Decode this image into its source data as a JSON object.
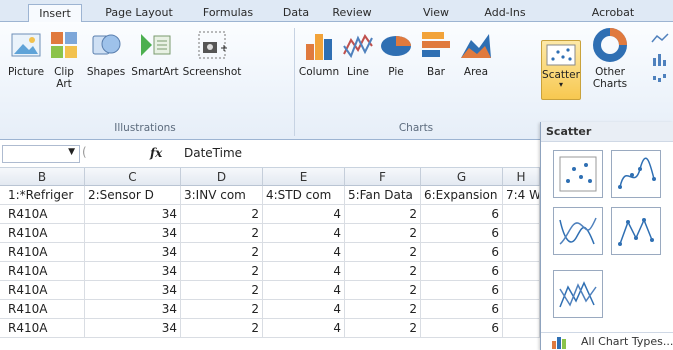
{
  "ribbon_tabs": [
    "Insert",
    "Page Layout",
    "Formulas",
    "Data",
    "Review",
    "View",
    "Add-Ins",
    "Acrobat"
  ],
  "illustrations": {
    "buttons": [
      "Picture",
      "Clip Art",
      "Shapes",
      "SmartArt",
      "Screenshot"
    ],
    "group_label": "Illustrations"
  },
  "charts": {
    "buttons": [
      "Column",
      "Line",
      "Pie",
      "Bar",
      "Area",
      "Scatter",
      "Other Charts"
    ],
    "group_label": "Charts"
  },
  "formula_bar": {
    "fx": "fx",
    "value": "DateTime"
  },
  "columns": [
    "B",
    "C",
    "D",
    "E",
    "F",
    "G",
    "H"
  ],
  "header_row": [
    "1:*Refriger",
    "2:Sensor D",
    "3:INV com",
    "4:STD com",
    "5:Fan Data",
    "6:Expansion",
    "7:4 W"
  ],
  "rows": [
    [
      "R410A",
      "34",
      "2",
      "4",
      "2",
      "6"
    ],
    [
      "R410A",
      "34",
      "2",
      "4",
      "2",
      "6"
    ],
    [
      "R410A",
      "34",
      "2",
      "4",
      "2",
      "6"
    ],
    [
      "R410A",
      "34",
      "2",
      "4",
      "2",
      "6"
    ],
    [
      "R410A",
      "34",
      "2",
      "4",
      "2",
      "6"
    ],
    [
      "R410A",
      "34",
      "2",
      "4",
      "2",
      "6"
    ],
    [
      "R410A",
      "34",
      "2",
      "4",
      "2",
      "6"
    ]
  ],
  "gallery": {
    "title": "Scatter",
    "all_chart_types": "All Chart Types..."
  }
}
